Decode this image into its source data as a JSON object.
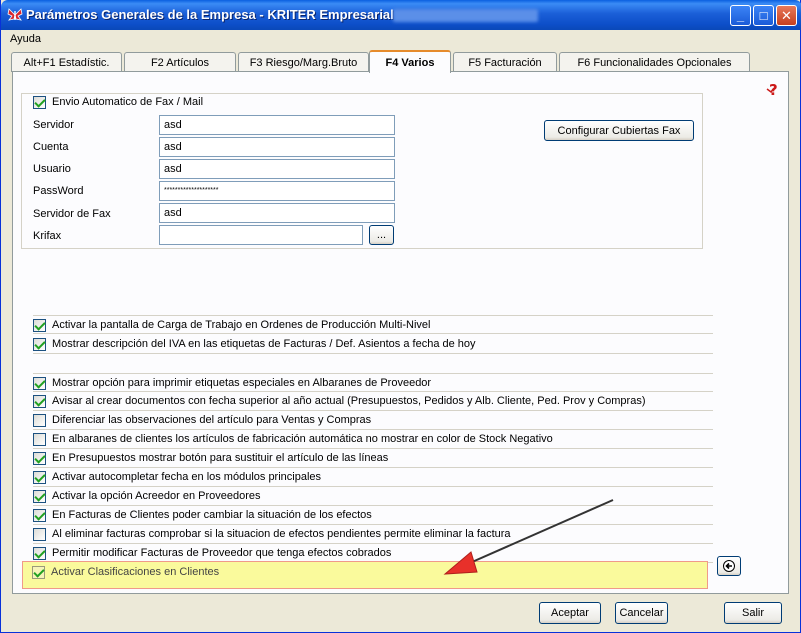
{
  "window": {
    "title": "Parámetros Generales de la Empresa - KRITER Empresarial",
    "title_icon": "app-butterfly-icon",
    "controls": {
      "minimize": "_",
      "maximize": "□",
      "close": "✕"
    }
  },
  "menu": {
    "help": "Ayuda"
  },
  "tabs": [
    {
      "label": "Alt+F1 Estadístic.",
      "active": false
    },
    {
      "label": "F2 Artículos",
      "active": false
    },
    {
      "label": "F3 Riesgo/Marg.Bruto",
      "active": false
    },
    {
      "label": "F4 Varios",
      "active": true
    },
    {
      "label": "F5 Facturación",
      "active": false
    },
    {
      "label": "F6 Funcionalidades Opcionales",
      "active": false
    }
  ],
  "fax": {
    "enable_label": "Envio Automatico de Fax / Mail",
    "enabled": true,
    "fields": [
      {
        "label": "Servidor",
        "value": "asd"
      },
      {
        "label": "Cuenta",
        "value": "asd"
      },
      {
        "label": "Usuario",
        "value": "asd"
      },
      {
        "label": "PassWord",
        "value": "********************"
      },
      {
        "label": "Servidor de Fax",
        "value": "asd"
      },
      {
        "label": "Krifax",
        "value": ""
      }
    ],
    "browse_label": "...",
    "config_button": "Configurar Cubiertas Fax"
  },
  "options_group1": [
    {
      "label": "Activar la pantalla de Carga de Trabajo en Ordenes de Producción Multi-Nivel",
      "checked": true
    },
    {
      "label": "Mostrar descripción del IVA en las etiquetas de Facturas / Def. Asientos a fecha de hoy",
      "checked": true
    }
  ],
  "options_group2": [
    {
      "label": "Mostrar opción para imprimir etiquetas especiales en Albaranes de Proveedor",
      "checked": true
    },
    {
      "label": "Avisar al crear documentos con fecha superior al año actual (Presupuestos, Pedidos y  Alb. Cliente, Ped. Prov y Compras)",
      "checked": true
    },
    {
      "label": "Diferenciar las observaciones del artículo para Ventas y Compras",
      "checked": false
    },
    {
      "label": "En albaranes de clientes los artículos de fabricación automática no mostrar en color de Stock Negativo",
      "checked": false
    },
    {
      "label": "En Presupuestos mostrar botón para sustituir el artículo de las líneas",
      "checked": true
    },
    {
      "label": "Activar autocompletar fecha en los módulos principales",
      "checked": true
    },
    {
      "label": "Activar la opción Acreedor en Proveedores",
      "checked": true
    },
    {
      "label": "En Facturas de Clientes poder cambiar la situación de los efectos",
      "checked": true
    },
    {
      "label": "Al eliminar facturas comprobar si la situacion de efectos pendientes permite eliminar la factura",
      "checked": false
    },
    {
      "label": "Permitir modificar Facturas de Proveedor que tenga efectos cobrados",
      "checked": true
    },
    {
      "label": "Activar Clasificaciones en Clientes",
      "checked": true
    }
  ],
  "footer": {
    "accept": "Aceptar",
    "cancel": "Cancelar",
    "exit": "Salir"
  },
  "colors": {
    "highlight_fill": "#fafa9c",
    "highlight_border": "#f09a8a",
    "arrow_head": "#e8302a"
  }
}
